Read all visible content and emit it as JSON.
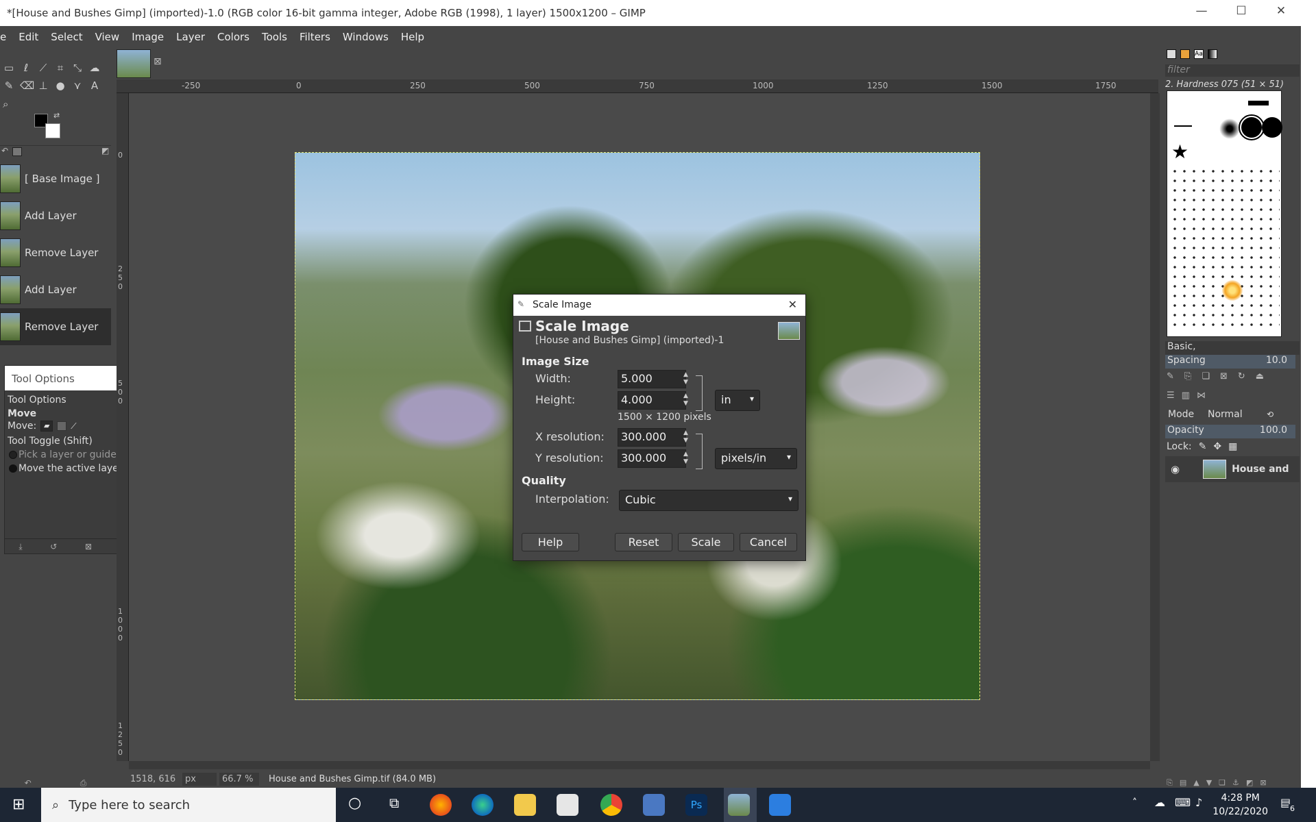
{
  "window": {
    "title": "*[House and Bushes Gimp] (imported)-1.0 (RGB color 16-bit gamma integer, Adobe RGB (1998), 1 layer) 1500x1200 – GIMP",
    "minimize": "—",
    "maximize": "☐",
    "close": "✕"
  },
  "menu": [
    "e",
    "Edit",
    "Select",
    "View",
    "Image",
    "Layer",
    "Colors",
    "Tools",
    "Filters",
    "Windows",
    "Help"
  ],
  "ruler": {
    "ticks": [
      "-250",
      "0",
      "250",
      "500",
      "750",
      "1000",
      "1250",
      "1500",
      "1750"
    ],
    "vticks": [
      "0",
      "2 5 0",
      "5 0 0",
      "1 0 0 0",
      "1 2 5 0"
    ]
  },
  "history": {
    "items": [
      "[ Base Image ]",
      "Add Layer",
      "Remove Layer",
      "Add Layer",
      "Remove Layer"
    ],
    "selected_index": 4
  },
  "tool_options": {
    "window_title": "Tool Options",
    "tab_label": "Tool Options",
    "tool_name": "Move",
    "move_label": "Move:",
    "toggle_label": "Tool Toggle  (Shift)",
    "option_pick": "Pick a layer or guide",
    "option_move_active": "Move the active layer"
  },
  "status": {
    "coords": "1518, 616",
    "unit": "px",
    "zoom": "66.7 %",
    "file_info": "House and Bushes Gimp.tif (84.0 MB)"
  },
  "brushes": {
    "filter_placeholder": "filter",
    "current": "2. Hardness 075 (51 × 51)",
    "preset": "Basic,",
    "spacing_label": "Spacing",
    "spacing_value": "10.0"
  },
  "layers": {
    "mode_label": "Mode",
    "mode_value": "Normal",
    "opacity_label": "Opacity",
    "opacity_value": "100.0",
    "lock_label": "Lock:",
    "layer_name": "House and"
  },
  "dialog": {
    "window_title": "Scale Image",
    "header": "Scale Image",
    "subheader": "[House and Bushes Gimp] (imported)-1",
    "image_size_label": "Image Size",
    "width_label": "Width:",
    "width_value": "5.000",
    "height_label": "Height:",
    "height_value": "4.000",
    "size_unit": "in",
    "pixels_text": "1500 × 1200 pixels",
    "xres_label": "X resolution:",
    "xres_value": "300.000",
    "yres_label": "Y resolution:",
    "yres_value": "300.000",
    "res_unit": "pixels/in",
    "quality_label": "Quality",
    "interp_label": "Interpolation:",
    "interp_value": "Cubic",
    "help": "Help",
    "reset": "Reset",
    "scale": "Scale",
    "cancel": "Cancel"
  },
  "taskbar": {
    "search_placeholder": "Type here to search",
    "time": "4:28 PM",
    "date": "10/22/2020",
    "notification_count": "6"
  }
}
